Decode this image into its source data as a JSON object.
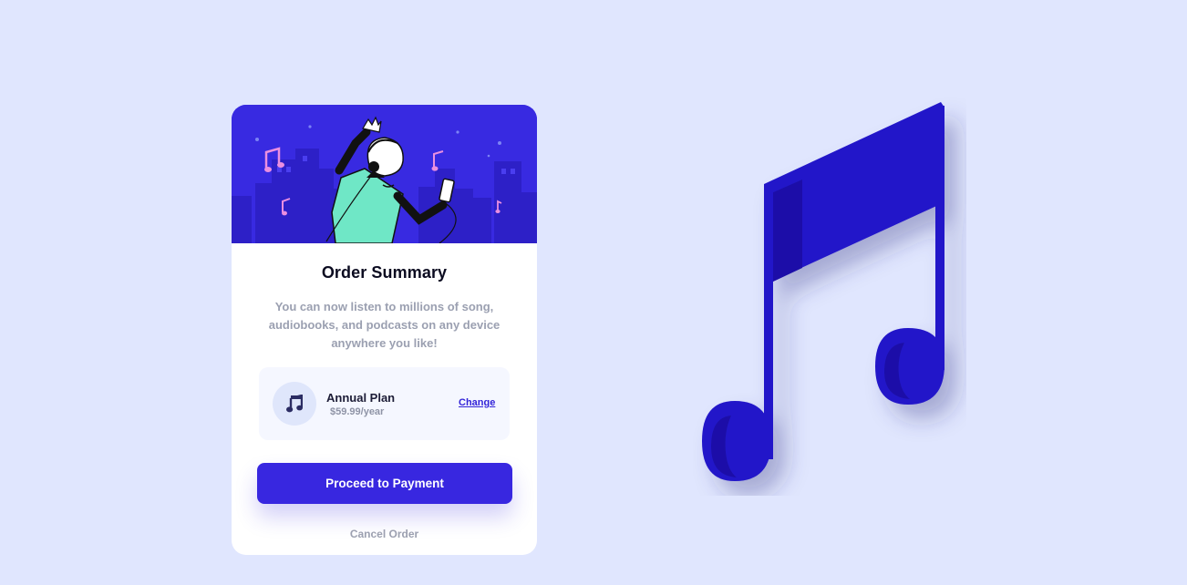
{
  "card": {
    "title": "Order Summary",
    "description": "You can now listen to millions of song, audiobooks, and podcasts on any device anywhere you like!",
    "plan": {
      "icon": "music-note-icon",
      "name": "Annual Plan",
      "price": "$59.99/year",
      "change_label": "Change"
    },
    "primary_button_label": "Proceed to Payment",
    "cancel_label": "Cancel Order"
  },
  "hero": {
    "illustration": "person-dancing-with-headphones-illustration"
  },
  "decoration": {
    "icon": "large-music-note-icon"
  },
  "colors": {
    "page_background": "#e0e6fe",
    "accent": "#382ae1",
    "card_background": "#ffffff",
    "plan_background": "#f5f7ff",
    "music_note": "#2419c9"
  }
}
